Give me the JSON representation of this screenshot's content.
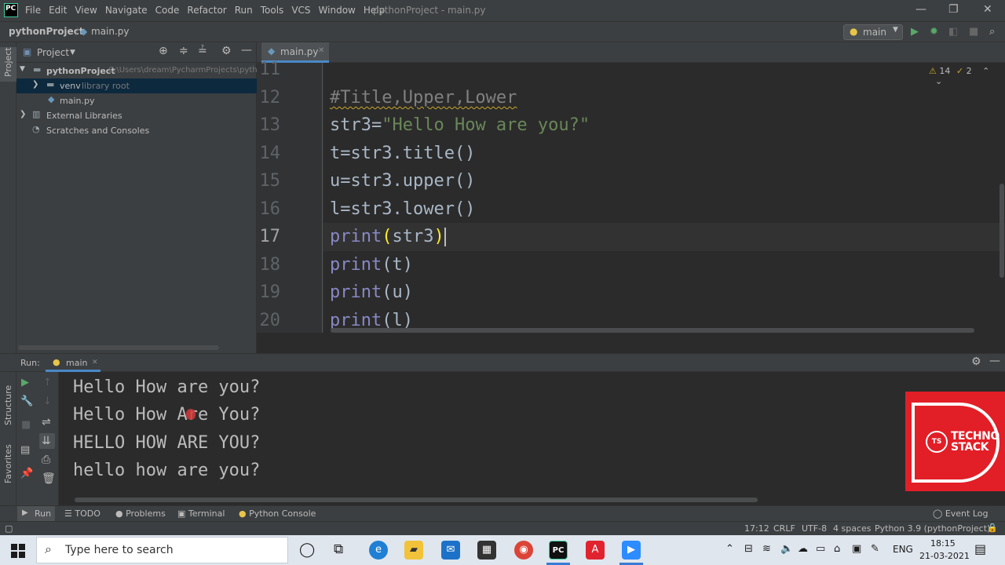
{
  "titlebar": {
    "menu": [
      "File",
      "Edit",
      "View",
      "Navigate",
      "Code",
      "Refactor",
      "Run",
      "Tools",
      "VCS",
      "Window",
      "Help"
    ],
    "title": "pythonProject - main.py",
    "logo_text": "PC"
  },
  "navbar": {
    "project": "pythonProject",
    "file": "main.py",
    "run_config": "main"
  },
  "left_tabs": {
    "project": "Project",
    "structure": "Structure",
    "favorites": "Favorites"
  },
  "project_panel": {
    "header": "Project",
    "tree": [
      {
        "label": "pythonProject",
        "hint": "C:\\Users\\dream\\PycharmProjects\\pyth"
      },
      {
        "label": "venv",
        "hint": "library root"
      },
      {
        "label": "main.py",
        "hint": ""
      },
      {
        "label": "External Libraries",
        "hint": ""
      },
      {
        "label": "Scratches and Consoles",
        "hint": ""
      }
    ]
  },
  "editor": {
    "tab": "main.py",
    "warnings": "14",
    "weak_warnings": "2",
    "line_numbers": [
      "11",
      "12",
      "13",
      "14",
      "15",
      "16",
      "17",
      "18",
      "19",
      "20"
    ],
    "current_line": "17",
    "lines": {
      "l12": "#Title,Upper,Lower",
      "l13a": "str3=",
      "l13b": "\"Hello How are you?\"",
      "l14": "t=str3.title()",
      "l15": "u=str3.upper()",
      "l16": "l=str3.lower()",
      "print": "print",
      "l17a": "(",
      "l17b": "str3",
      "l17c": ")",
      "l18": "(t)",
      "l19": "(u)",
      "l20": "(l)"
    }
  },
  "run_panel": {
    "label": "Run:",
    "tab": "main",
    "output": [
      "Hello How are you?",
      "Hello How Are You?",
      "HELLO HOW ARE YOU?",
      "hello how are you?"
    ]
  },
  "bottom_tabs": [
    "Run",
    "TODO",
    "Problems",
    "Terminal",
    "Python Console"
  ],
  "event_log": "Event Log",
  "status": {
    "position": "17:12",
    "line_sep": "CRLF",
    "encoding": "UTF-8",
    "indent": "4 spaces",
    "interpreter": "Python 3.9 (pythonProject)"
  },
  "taskbar": {
    "search_placeholder": "Type here to search",
    "lang": "ENG",
    "time": "18:15",
    "date": "21-03-2021"
  },
  "logo": {
    "line1": "TECHNO",
    "line2": "STACK",
    "badge": "TS"
  },
  "colors": {
    "accent": "#4a88c7",
    "keyword": "#8888c6",
    "string": "#6a8759",
    "logo_bg": "#e21e26"
  }
}
